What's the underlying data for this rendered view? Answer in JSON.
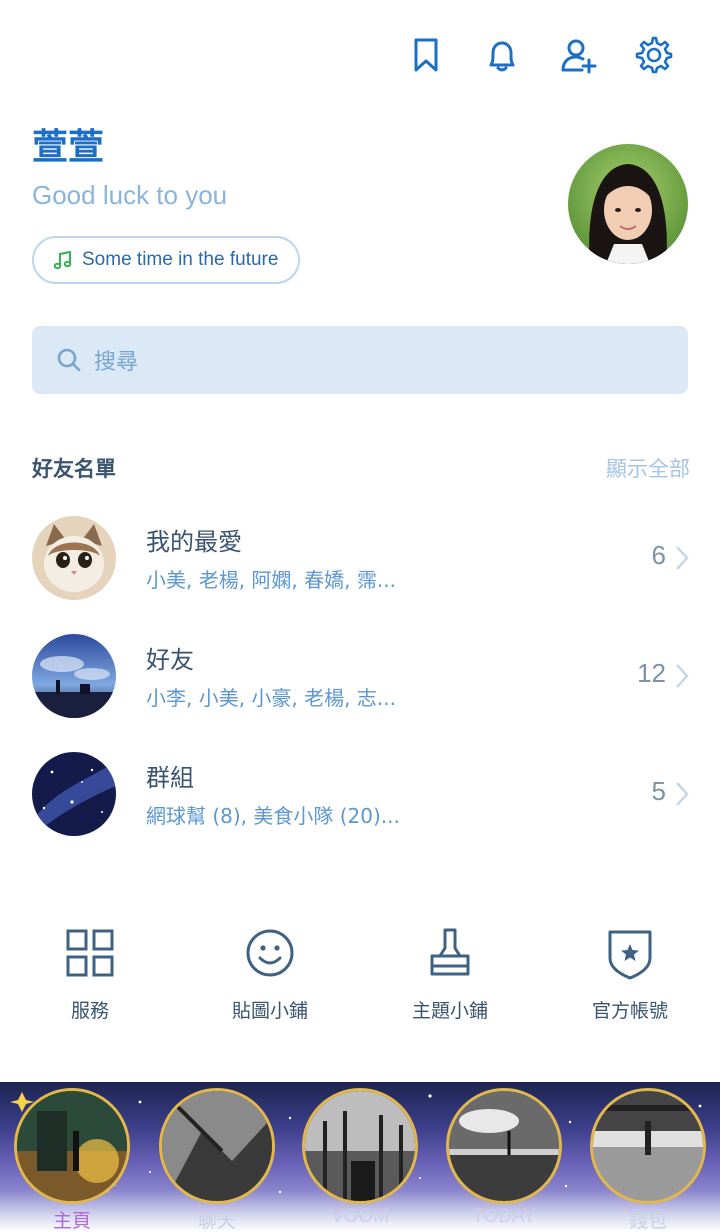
{
  "header": {
    "icons": [
      "bookmark-icon",
      "bell-icon",
      "add-friend-icon",
      "gear-icon"
    ]
  },
  "profile": {
    "name": "萱萱",
    "status": "Good luck to you",
    "music": "Some time in the future"
  },
  "search": {
    "placeholder": "搜尋"
  },
  "friends_section": {
    "title": "好友名單",
    "show_all": "顯示全部",
    "rows": [
      {
        "title": "我的最愛",
        "members": "小美, 老楊, 阿嫻, 春嬌, 霈...",
        "count": "6"
      },
      {
        "title": "好友",
        "members": "小李, 小美, 小豪, 老楊, 志...",
        "count": "12"
      },
      {
        "title": "群組",
        "members": "網球幫 (8), 美食小隊 (20)...",
        "count": "5"
      }
    ]
  },
  "services": [
    {
      "label": "服務",
      "icon": "grid-icon"
    },
    {
      "label": "貼圖小鋪",
      "icon": "smiley-icon"
    },
    {
      "label": "主題小鋪",
      "icon": "brush-icon"
    },
    {
      "label": "官方帳號",
      "icon": "shield-star-icon"
    }
  ],
  "tabs": [
    {
      "label": "主頁",
      "active": true
    },
    {
      "label": "聊天",
      "active": false
    },
    {
      "label": "VOOM",
      "active": false
    },
    {
      "label": "TODAY",
      "active": false
    },
    {
      "label": "錢包",
      "active": false
    }
  ],
  "colors": {
    "accent": "#1b6fc7",
    "status_text": "#8ab4de",
    "search_bg": "#dbe8f5",
    "active_tab": "#b06ad6",
    "ring": "#e3b74a"
  }
}
